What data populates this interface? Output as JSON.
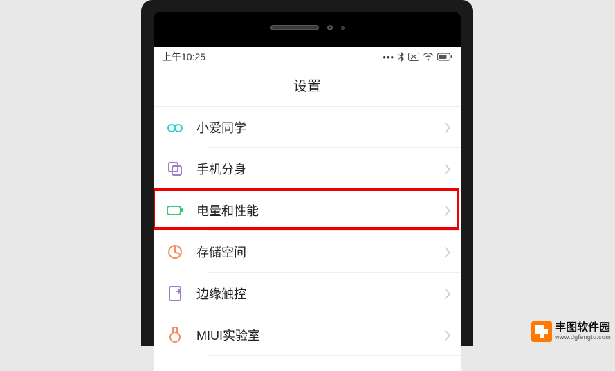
{
  "status": {
    "time": "上午10:25"
  },
  "header": {
    "title": "设置"
  },
  "menu": {
    "items": [
      {
        "label": "小爱同学",
        "icon": "xiaoai",
        "color": "#2dd3c6"
      },
      {
        "label": "手机分身",
        "icon": "dual-app",
        "color": "#9a7dcc"
      },
      {
        "label": "电量和性能",
        "icon": "battery",
        "color": "#3cc87a"
      },
      {
        "label": "存储空间",
        "icon": "storage",
        "color": "#f2905b"
      },
      {
        "label": "边缘触控",
        "icon": "edge-touch",
        "color": "#9a7dcc"
      },
      {
        "label": "MIUI实验室",
        "icon": "lab",
        "color": "#f2905b"
      }
    ]
  },
  "highlighted_index": 2,
  "watermark": {
    "name": "丰图软件园",
    "url": "www.dgfengtu.com"
  }
}
